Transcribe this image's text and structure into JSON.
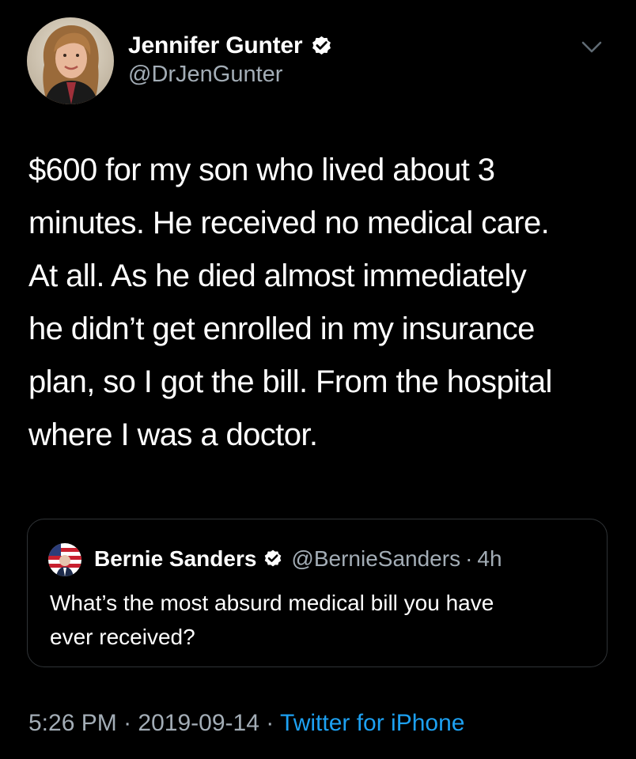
{
  "author": {
    "name": "Jennifer Gunter",
    "handle": "@DrJenGunter",
    "verified": true
  },
  "tweet": {
    "text_lines": [
      "$600 for my son who lived about 3",
      "minutes. He received no medical care.",
      "At all. As he died almost immediately",
      "he didn’t get enrolled in my insurance",
      "plan, so I got the bill.  From the hospital",
      "where I was a doctor."
    ]
  },
  "quoted_tweet": {
    "name": "Bernie Sanders",
    "handle": "@BernieSanders",
    "separator": "·",
    "age": "4h",
    "verified": true,
    "text_lines": [
      "What’s the most absurd medical bill you have",
      "ever received?"
    ]
  },
  "footer": {
    "time": "5:26 PM",
    "separator": "·",
    "date": "2019-09-14",
    "source": "Twitter for iPhone"
  },
  "icons": {
    "verified": "verified-badge-icon",
    "menu": "chevron-down-icon"
  },
  "colors": {
    "background": "#000000",
    "text": "#ffffff",
    "secondary_text": "#a3adb6",
    "link": "#1da1f2",
    "border": "#2f3336"
  }
}
